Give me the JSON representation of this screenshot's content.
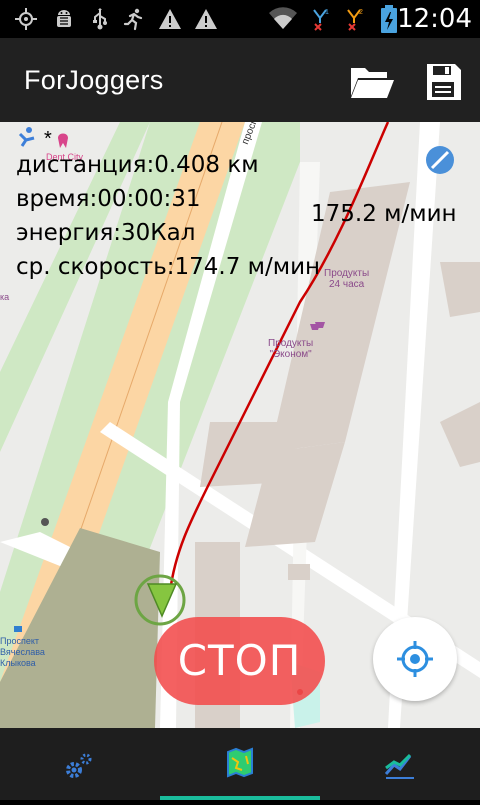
{
  "status_bar": {
    "time": "12:04",
    "icons": [
      "gps-icon",
      "android-debug-icon",
      "usb-icon",
      "running-icon",
      "warning-icon",
      "warning-icon",
      "wifi-icon",
      "signal-1-icon",
      "signal-2-icon",
      "battery-charging-icon"
    ]
  },
  "app_bar": {
    "title": "ForJoggers",
    "open_icon": "folder-open-icon",
    "save_icon": "save-icon"
  },
  "workout": {
    "distance": "дистанция:0.408 км",
    "time": "время:00:00:31",
    "energy": "энергия:30Кал",
    "avg_speed": "ср. скорость:174.7 м/мин",
    "current_speed": "175.2 м/мин"
  },
  "map": {
    "labels": {
      "shop1": "Продукты\n24 часа",
      "shop2": "Продукты\n\"Эконом\"",
      "dentist": "Dent City",
      "street_main": "проспект",
      "bus_stop": "Проспект\nВячеслава\nКлыкова",
      "edge_label": "ка",
      "asterisk": "*"
    },
    "route_color": "#cc0000"
  },
  "controls": {
    "stop_label": "СТОП",
    "locate_icon": "my-location-icon"
  },
  "bottom_nav": {
    "tabs": [
      {
        "icon": "settings-gears-icon",
        "selected": false
      },
      {
        "icon": "map-icon",
        "selected": true
      },
      {
        "icon": "stats-chart-icon",
        "selected": false
      }
    ],
    "accent": "#1abc9c"
  }
}
